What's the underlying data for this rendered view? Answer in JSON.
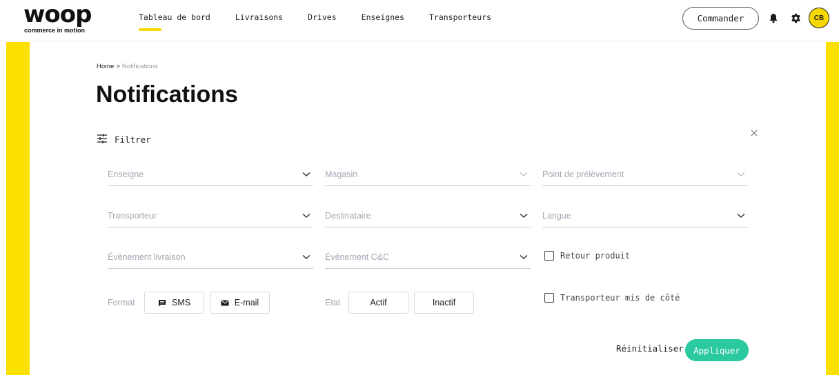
{
  "header": {
    "logo_text": "woop",
    "logo_tagline": "commerce in motion",
    "nav": [
      {
        "label": "Tableau de bord",
        "active": true
      },
      {
        "label": "Livraisons"
      },
      {
        "label": "Drives"
      },
      {
        "label": "Enseignes"
      },
      {
        "label": "Transporteurs"
      }
    ],
    "order_button": "Commander",
    "bell_icon": "bell-icon",
    "settings_icon": "gear-icon",
    "avatar_initials": "CB"
  },
  "colors": {
    "brand_yellow": "#fbe000",
    "apply_green": "#2bc9a0",
    "placeholder_gray": "#a5a6b3"
  },
  "breadcrumb": {
    "home": "Home",
    "separator": ">",
    "current": "Notifications"
  },
  "page_title": "Notifications",
  "filter": {
    "label": "Filtrer",
    "icon": "filter-sliders-icon",
    "close_icon": "close-icon",
    "selects": {
      "enseigne": "Enseigne",
      "magasin": "Magasin",
      "point_prelevement": "Point de prélèvement",
      "transporteur": "Transporteur",
      "destinataire": "Destinataire",
      "langue": "Langue",
      "evenement_livraison": "Évènement livraison",
      "evenement_cc": "Évènement C&C"
    },
    "format": {
      "label": "Format",
      "sms": "SMS",
      "email": "E-mail"
    },
    "etat": {
      "label": "Etat",
      "actif": "Actif",
      "inactif": "Inactif"
    },
    "checkboxes": {
      "retour_produit": "Retour produit",
      "transporteur_mis_de_cote": "Transporteur mis de côté"
    },
    "reset": "Réinitialiser",
    "apply": "Appliquer"
  }
}
